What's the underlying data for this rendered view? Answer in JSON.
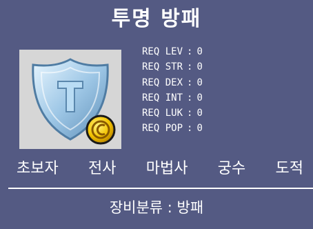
{
  "item": {
    "name": "투명 방패",
    "icon": "shield-icon"
  },
  "requirements": [
    {
      "label": "REQ LEV",
      "value": "0"
    },
    {
      "label": "REQ STR",
      "value": "0"
    },
    {
      "label": "REQ DEX",
      "value": "0"
    },
    {
      "label": "REQ INT",
      "value": "0"
    },
    {
      "label": "REQ LUK",
      "value": "0"
    },
    {
      "label": "REQ POP",
      "value": "0"
    }
  ],
  "separator": ":",
  "jobs": [
    "초보자",
    "전사",
    "마법사",
    "궁수",
    "도적"
  ],
  "category": {
    "text": "장비분류 : 방패"
  },
  "colors": {
    "background": "#545a83",
    "text": "#ffffff",
    "icon_background": "#d6d6d6",
    "shield": "#9ec7e6",
    "coin": "#f2c200"
  }
}
